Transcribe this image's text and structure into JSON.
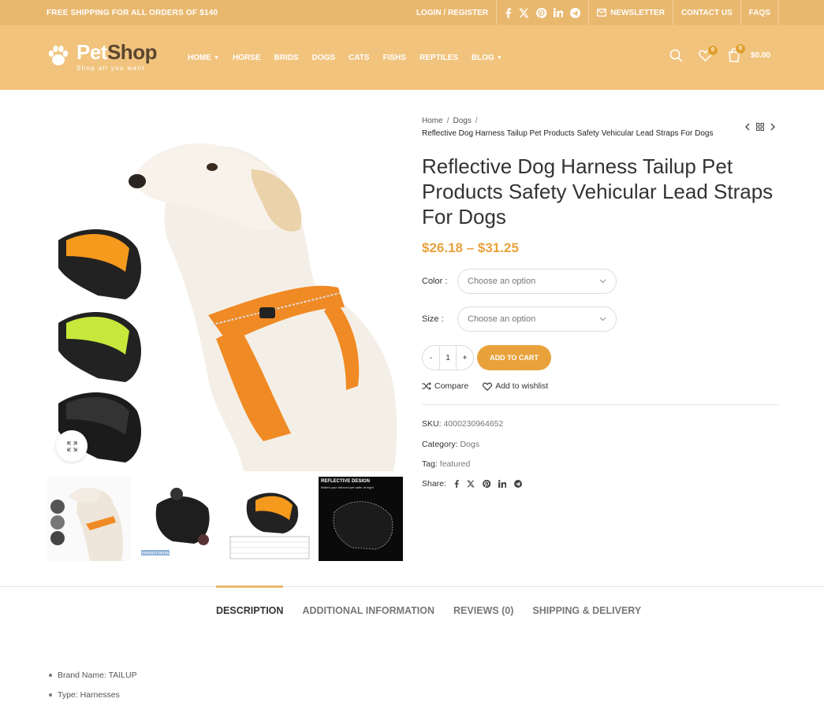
{
  "topbar": {
    "promo": "FREE SHIPPING FOR ALL ORDERS OF $140",
    "login": "LOGIN / REGISTER",
    "newsletter": "NEWSLETTER",
    "contact": "CONTACT US",
    "faqs": "FAQS",
    "social_icons": [
      "facebook-icon",
      "x-icon",
      "pinterest-icon",
      "linkedin-icon",
      "telegram-icon"
    ]
  },
  "logo": {
    "brand_light": "Pet",
    "brand_dark": "Shop",
    "tagline": "Shop all you want"
  },
  "nav": {
    "items": [
      "HOME",
      "HORSE",
      "BRIDS",
      "DOGS",
      "CATS",
      "FISHS",
      "REPTILES",
      "BLOG"
    ]
  },
  "header": {
    "wishlist_count": "0",
    "cart_count": "0",
    "cart_total": "$0.00"
  },
  "breadcrumb": {
    "home": "Home",
    "category": "Dogs",
    "sep": "/",
    "current": "Reflective Dog Harness Tailup Pet Products Safety Vehicular Lead Straps For Dogs"
  },
  "product": {
    "title": "Reflective Dog Harness Tailup Pet Products Safety Vehicular Lead Straps For Dogs",
    "price": "$26.18 – $31.25",
    "color_label": "Color",
    "size_label": "Size",
    "select_placeholder": "Choose an option",
    "quantity": "1",
    "minus": "-",
    "plus": "+",
    "add_to_cart": "ADD TO CART",
    "compare": "Compare",
    "wishlist": "Add to wishlist",
    "sku_label": "SKU:",
    "sku": "4000230964652",
    "category_label": "Category:",
    "category": "Dogs",
    "tag_label": "Tag:",
    "tag": "featured",
    "share_label": "Share:"
  },
  "thumbnails": {
    "thumb2_caption": "PRODUCT DETAILS",
    "thumb4_title": "REFLECTIVE DESIGN",
    "thumb4_subtitle": "Makes your beloved pet safer at night"
  },
  "tabs": [
    "DESCRIPTION",
    "ADDITIONAL INFORMATION",
    "REVIEWS (0)",
    "SHIPPING & DELIVERY"
  ],
  "description": [
    "Brand Name: TAILUP",
    "Type: Harnesses"
  ],
  "colors": {
    "topbar": "#e9b86f",
    "header": "#f1c37d",
    "accent": "#e9a23b"
  }
}
